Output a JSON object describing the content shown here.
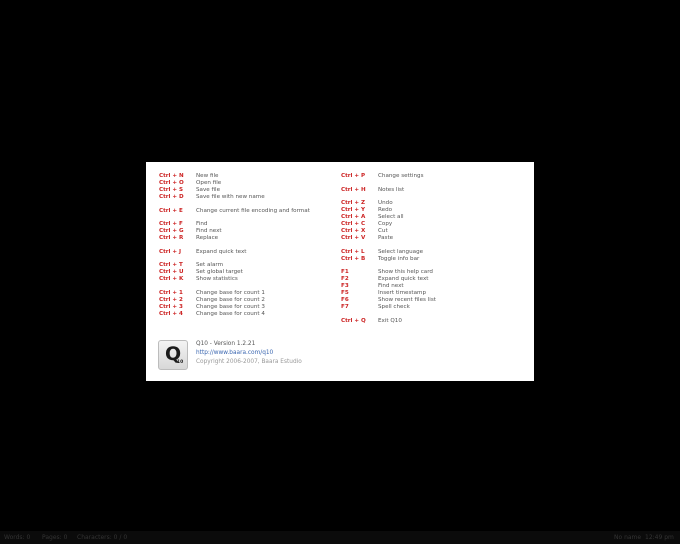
{
  "shortcuts_left": [
    [
      {
        "key": "Ctrl + N",
        "action": "New file"
      },
      {
        "key": "Ctrl + O",
        "action": "Open file"
      },
      {
        "key": "Ctrl + S",
        "action": "Save file"
      },
      {
        "key": "Ctrl + D",
        "action": "Save file with new name"
      }
    ],
    [
      {
        "key": "Ctrl + E",
        "action": "Change current file encoding and format"
      }
    ],
    [
      {
        "key": "Ctrl + F",
        "action": "Find"
      },
      {
        "key": "Ctrl + G",
        "action": "Find next"
      },
      {
        "key": "Ctrl + R",
        "action": "Replace"
      }
    ],
    [
      {
        "key": "Ctrl + J",
        "action": "Expand quick text"
      }
    ],
    [
      {
        "key": "Ctrl + T",
        "action": "Set alarm"
      },
      {
        "key": "Ctrl + U",
        "action": "Set global target"
      },
      {
        "key": "Ctrl + K",
        "action": "Show statistics"
      }
    ],
    [
      {
        "key": "Ctrl + 1",
        "action": "Change base for count 1"
      },
      {
        "key": "Ctrl + 2",
        "action": "Change base for count 2"
      },
      {
        "key": "Ctrl + 3",
        "action": "Change base for count 3"
      },
      {
        "key": "Ctrl + 4",
        "action": "Change base for count 4"
      }
    ]
  ],
  "shortcuts_right": [
    [
      {
        "key": "Ctrl + P",
        "action": "Change settings"
      }
    ],
    [
      {
        "key": "Ctrl + H",
        "action": "Notes list"
      }
    ],
    [
      {
        "key": "Ctrl + Z",
        "action": "Undo"
      },
      {
        "key": "Ctrl + Y",
        "action": "Redo"
      },
      {
        "key": "Ctrl + A",
        "action": "Select all"
      },
      {
        "key": "Ctrl + C",
        "action": "Copy"
      },
      {
        "key": "Ctrl + X",
        "action": "Cut"
      },
      {
        "key": "Ctrl + V",
        "action": "Paste"
      }
    ],
    [
      {
        "key": "Ctrl + L",
        "action": "Select language"
      },
      {
        "key": "Ctrl + B",
        "action": "Toggle info bar"
      }
    ],
    [
      {
        "key": "F1",
        "action": "Show this help card"
      },
      {
        "key": "F2",
        "action": "Expand quick text"
      },
      {
        "key": "F3",
        "action": "Find next"
      },
      {
        "key": "F5",
        "action": "Insert timestamp"
      },
      {
        "key": "F6",
        "action": "Show recent files list"
      },
      {
        "key": "F7",
        "action": "Spell check"
      }
    ],
    [
      {
        "key": "Ctrl + Q",
        "action": "Exit Q10"
      }
    ]
  ],
  "about": {
    "icon_letter": "Q",
    "icon_sub": "10",
    "version": "Q10 - Version 1.2.21",
    "url": "http://www.baara.com/q10",
    "copyright": "Copyright 2006-2007, Baara Estudio"
  },
  "status_bar": {
    "words": "Words: 0",
    "pages": "Pages: 0",
    "characters": "Characters: 0 / 0",
    "file_name": "No name",
    "time": "12:49 pm"
  },
  "colors": {
    "background": "#000000",
    "card": "#ffffff",
    "shortcut_key": "#cc2222",
    "url": "#3a66b0"
  }
}
